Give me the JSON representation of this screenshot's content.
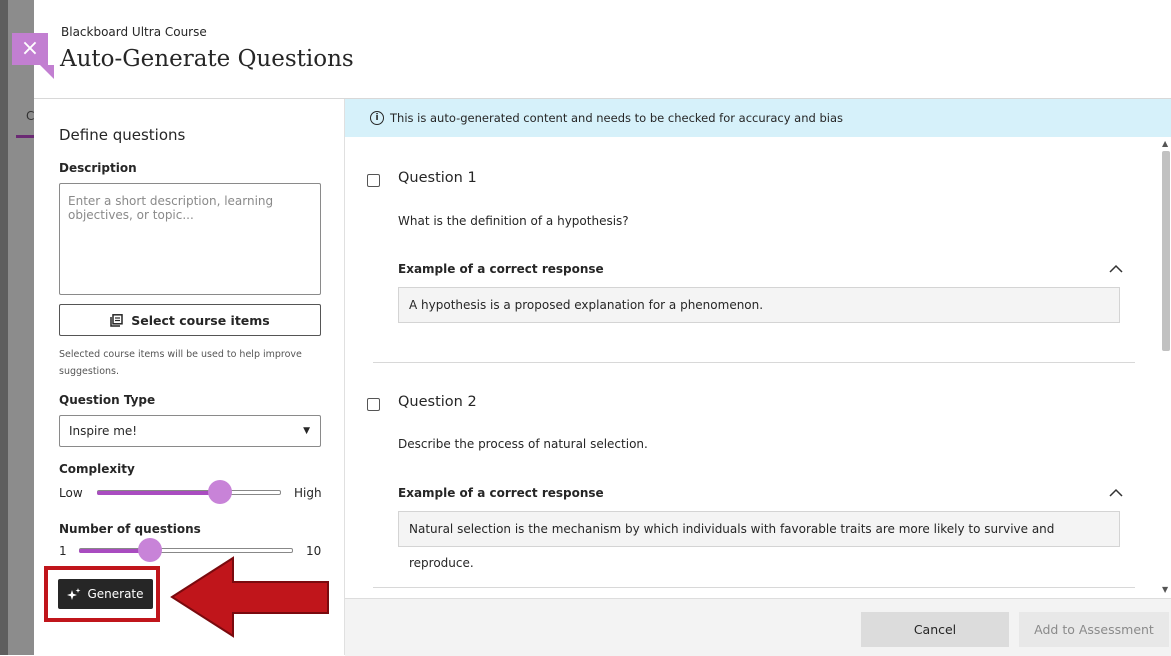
{
  "header": {
    "breadcrumb": "Blackboard Ultra Course",
    "title": "Auto-Generate Questions",
    "close_icon": "×"
  },
  "left_panel": {
    "title": "Define questions",
    "description_label": "Description",
    "description_placeholder": "Enter a short description, learning objectives, or topic...",
    "select_items_label": "Select course items",
    "helper_text": "Selected course items will be used to help improve suggestions.",
    "question_type_label": "Question Type",
    "question_type_value": "Inspire me!",
    "complexity_label": "Complexity",
    "complexity_low": "Low",
    "complexity_high": "High",
    "complexity_level": 0.67,
    "num_questions_label": "Number of questions",
    "num_min": "1",
    "num_max": "10",
    "num_level": 0.33,
    "generate_label": "Generate"
  },
  "notice": {
    "text": "This is auto-generated content and needs to be checked for accuracy and bias"
  },
  "questions": [
    {
      "title": "Question 1",
      "text": "What is the definition of a hypothesis?",
      "answer_label": "Example of a correct response",
      "answer": "A hypothesis is a proposed explanation for a phenomenon."
    },
    {
      "title": "Question 2",
      "text": "Describe the process of natural selection.",
      "answer_label": "Example of a correct response",
      "answer": "Natural selection is the mechanism by which individuals with favorable traits are more likely to survive and reproduce."
    }
  ],
  "footer": {
    "cancel_label": "Cancel",
    "add_label": "Add to Assessment"
  },
  "background": {
    "left_tab_letter": "C"
  },
  "colors": {
    "accent_purple": "#a94cc0",
    "close_purple": "#c27fd1",
    "highlight_red": "#c0151b",
    "notice_bg": "#d6f1fa"
  }
}
